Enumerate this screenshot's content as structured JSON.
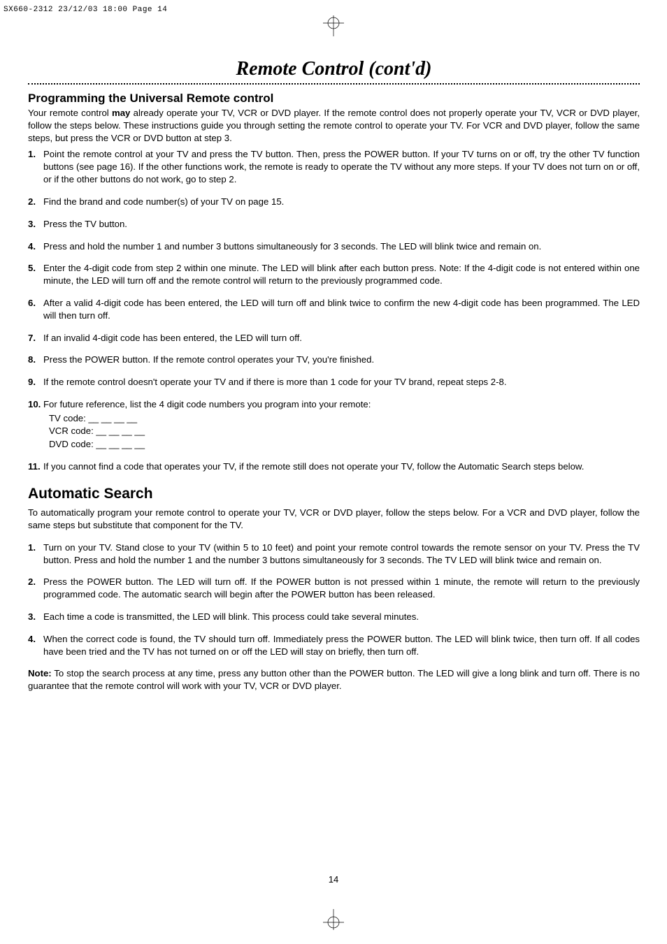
{
  "header_line": "SX660-2312  23/12/03  18:00  Page 14",
  "title": "Remote Control (cont'd)",
  "prog_heading": "Programming the Universal Remote control",
  "prog_intro_html": "Your remote control <b>may</b> already operate your TV, VCR or DVD player. If the remote control does not properly operate your TV, VCR or DVD player, follow the steps below. These instructions guide you through setting the remote control to operate your TV. For VCR and DVD player, follow the same steps, but press the VCR or DVD button at step 3.",
  "prog_steps": [
    {
      "n": "1.",
      "t": "Point the remote control at your TV and press the TV button. Then, press the POWER button. If your TV turns on or off, try the other TV function buttons (see page 16). If the other functions work, the remote is ready to operate the TV without any more steps. If your TV does not turn on or off, or if the other buttons do not work, go to step 2."
    },
    {
      "n": "2.",
      "t": "Find the brand and code number(s) of your TV on page 15."
    },
    {
      "n": "3.",
      "t": "Press the TV button."
    },
    {
      "n": "4.",
      "t": "Press and hold the number 1 and number 3 buttons simultaneously for 3 seconds. The LED will blink twice and remain on."
    },
    {
      "n": "5.",
      "t": "Enter the 4-digit code from step 2 within one minute. The LED will blink after each button press. Note: If the 4-digit code is not entered within one minute, the LED will turn off and the remote control will return to the previously programmed code."
    },
    {
      "n": "6.",
      "t": "After a valid 4-digit code has been entered, the LED will turn off and blink twice to confirm the new 4-digit code has been programmed. The LED will then turn off."
    },
    {
      "n": "7.",
      "t": "If an invalid 4-digit code has been entered, the LED will turn off."
    },
    {
      "n": "8.",
      "t": "Press the POWER button. If the remote control operates your TV, you're finished."
    },
    {
      "n": "9.",
      "t": "If the remote control doesn't operate your TV and if there is more than 1 code for your TV brand, repeat steps 2-8."
    },
    {
      "n": "10.",
      "t": "For future reference, list the 4 digit code numbers you program into your remote:"
    },
    {
      "n": "11.",
      "t": "If you cannot find a code that operates your TV, if the remote still does not operate your TV, follow the Automatic Search steps below."
    }
  ],
  "codes": {
    "tv": "TV code:   __ __ __ __",
    "vcr": "VCR code:  __ __ __ __",
    "dvd": "DVD code:  __  __ __ __"
  },
  "auto_heading": "Automatic Search",
  "auto_intro": "To automatically program your remote control to operate your TV,  VCR or DVD player, follow the steps below. For a VCR and DVD player, follow the same steps but substitute that component for the TV.",
  "auto_steps": [
    {
      "n": "1.",
      "t": "Turn on your TV. Stand close to your TV (within 5 to 10 feet) and point your remote control towards the remote sensor on your TV. Press the TV button. Press and hold the number 1 and the number 3 buttons simultaneously for 3 seconds. The TV LED will blink twice and remain on."
    },
    {
      "n": "2.",
      "t": "Press the POWER button. The LED will turn off. If the POWER button is not pressed within 1 minute, the remote will return to the previously programmed code. The automatic search will begin after the POWER button has been released."
    },
    {
      "n": "3.",
      "t": "Each time a code is transmitted, the LED will blink. This process could take several minutes."
    },
    {
      "n": "4.",
      "t": "When the correct code is found, the TV should turn off. Immediately press the POWER button. The LED will blink twice, then turn off. If all codes have been tried and the TV has not turned on or off the LED will stay on briefly, then turn off."
    }
  ],
  "note_html": "<b>Note:</b> To stop the search process at any time, press any button other than the POWER button. The LED will give a long blink and turn off. There is no guarantee that the remote control will work with your TV,  VCR or DVD player.",
  "page_number": "14"
}
